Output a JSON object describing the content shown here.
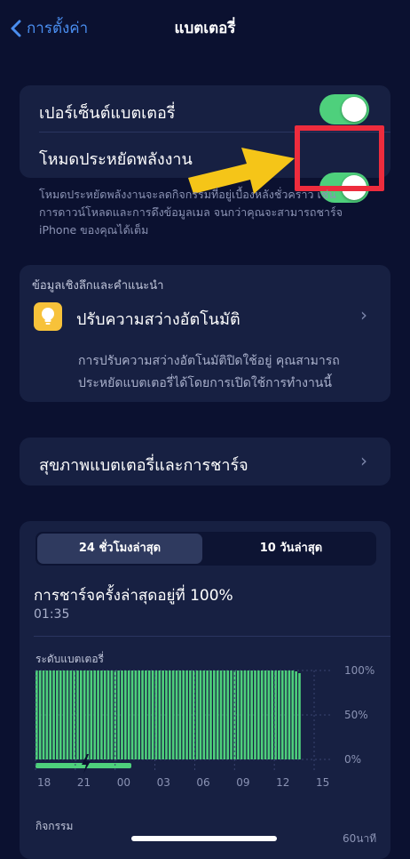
{
  "nav": {
    "back_label": "การตั้งค่า",
    "title": "แบตเตอรี่"
  },
  "settings": {
    "battery_percentage": {
      "label": "เปอร์เซ็นต์แบตเตอรี่",
      "on": true
    },
    "low_power_mode": {
      "label": "โหมดประหยัดพลังงาน",
      "on": true
    },
    "footnote_lines": [
      "โหมดประหยัดพลังงานจะลดกิจกรรมที่อยู่เบื้องหลังชั่วคราว เช่น",
      "การดาวน์โหลดและการดึงข้อมูลเมล จนกว่าคุณจะสามารถชาร์จ",
      "iPhone ของคุณได้เต็ม"
    ]
  },
  "insights": {
    "header": "ข้อมูลเชิงลึกและคำแนะนำ",
    "item_title": "ปรับความสว่างอัตโนมัติ",
    "desc_lines": [
      "การปรับความสว่างอัตโนมัติปิดใช้อยู่ คุณสามารถ",
      "ประหยัดแบตเตอรี่ได้โดยการเปิดใช้การทำงานนี้"
    ]
  },
  "health": {
    "label": "สุขภาพแบตเตอรี่และการชาร์จ"
  },
  "usage": {
    "segments": [
      "24 ชั่วโมงล่าสุด",
      "10 วันล่าสุด"
    ],
    "selected_segment": "24 ชั่วโมงล่าสุด",
    "last_charge_title": "การชาร์จครั้งล่าสุดอยู่ที่ 100%",
    "last_charge_time": "01:35",
    "chart_title": "ระดับแบตเตอรี่",
    "activity_label": "กิจกรรม",
    "activity_axis_top": "60นาที"
  },
  "chart_data": {
    "type": "bar",
    "title": "ระดับแบตเตอรี่",
    "x_tick_labels": [
      "18",
      "21",
      "00",
      "03",
      "06",
      "09",
      "12",
      "15"
    ],
    "y_tick_labels": [
      "100%",
      "50%",
      "0%"
    ],
    "ylim": [
      0,
      100
    ],
    "bar_count": 74,
    "values_percent": [
      100,
      100,
      100,
      100,
      100,
      100,
      100,
      100,
      100,
      100,
      100,
      100,
      100,
      100,
      100,
      100,
      100,
      100,
      100,
      100,
      100,
      100,
      100,
      100,
      100,
      100,
      100,
      100,
      100,
      100,
      100,
      100,
      100,
      100,
      100,
      100,
      100,
      100,
      100,
      100,
      100,
      100,
      100,
      100,
      100,
      100,
      100,
      100,
      100,
      100,
      100,
      100,
      100,
      100,
      100,
      100,
      100,
      100,
      100,
      100,
      100,
      100,
      100,
      100,
      100,
      100,
      100,
      100,
      100,
      100,
      100,
      100,
      100,
      100,
      100,
      100,
      99,
      97
    ],
    "charging_indicator_label": "charging",
    "bar_color": "#4ed07c",
    "grid": true
  },
  "colors": {
    "background": "#0b1130",
    "card": "#172042",
    "accent_blue": "#4a8ef0",
    "toggle_on": "#4ed07c",
    "highlight_red": "#ee2c3d",
    "arrow_yellow": "#f5c518"
  },
  "icons": {
    "back": "chevron-left-icon",
    "insight": "lightbulb-icon",
    "disclosure": "chevron-right-icon",
    "charging": "bolt-icon",
    "annotation": "arrow-right-icon"
  }
}
